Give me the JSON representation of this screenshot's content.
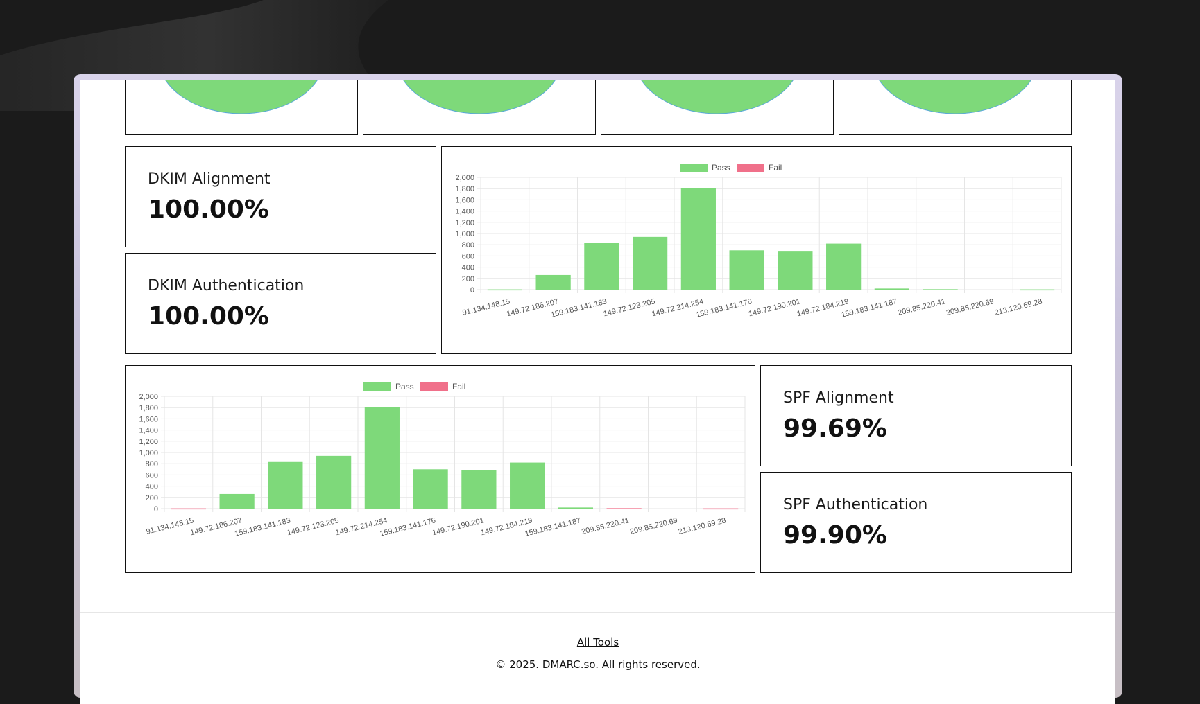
{
  "colors": {
    "pass": "#7ed97a",
    "fail": "#f0708a",
    "grid": "#e5e5e5",
    "axis_text": "#555555"
  },
  "stats": {
    "dkim_alignment": {
      "label": "DKIM Alignment",
      "value": "100.00%"
    },
    "dkim_authentication": {
      "label": "DKIM Authentication",
      "value": "100.00%"
    },
    "spf_alignment": {
      "label": "SPF Alignment",
      "value": "99.69%"
    },
    "spf_authentication": {
      "label": "SPF Authentication",
      "value": "99.90%"
    }
  },
  "footer": {
    "link": "All Tools",
    "copyright": "© 2025. DMARC.so. All rights reserved."
  },
  "chart_data": [
    {
      "type": "bar",
      "legend": [
        "Pass",
        "Fail"
      ],
      "legend_position": "top",
      "grid": true,
      "ylim": [
        0,
        2000
      ],
      "yticks": [
        "0",
        "200",
        "400",
        "600",
        "800",
        "1,000",
        "1,200",
        "1,400",
        "1,600",
        "1,800",
        "2,000"
      ],
      "categories": [
        "91.134.148.15",
        "149.72.186.207",
        "159.183.141.183",
        "149.72.123.205",
        "149.72.214.254",
        "159.183.141.176",
        "149.72.190.201",
        "149.72.184.219",
        "159.183.141.187",
        "209.85.220.41",
        "209.85.220.69",
        "213.120.69.28"
      ],
      "series": [
        {
          "name": "Pass",
          "values": [
            5,
            260,
            830,
            940,
            1810,
            700,
            690,
            820,
            20,
            8,
            0,
            5
          ]
        },
        {
          "name": "Fail",
          "values": [
            0,
            0,
            0,
            0,
            0,
            0,
            0,
            0,
            0,
            0,
            0,
            0
          ]
        }
      ]
    },
    {
      "type": "bar",
      "legend": [
        "Pass",
        "Fail"
      ],
      "legend_position": "top",
      "grid": true,
      "ylim": [
        0,
        2000
      ],
      "yticks": [
        "0",
        "200",
        "400",
        "600",
        "800",
        "1,000",
        "1,200",
        "1,400",
        "1,600",
        "1,800",
        "2,000"
      ],
      "categories": [
        "91.134.148.15",
        "149.72.186.207",
        "159.183.141.183",
        "149.72.123.205",
        "149.72.214.254",
        "159.183.141.176",
        "149.72.190.201",
        "149.72.184.219",
        "159.183.141.187",
        "209.85.220.41",
        "209.85.220.69",
        "213.120.69.28"
      ],
      "series": [
        {
          "name": "Pass",
          "values": [
            0,
            260,
            830,
            940,
            1810,
            700,
            690,
            820,
            20,
            0,
            0,
            0
          ]
        },
        {
          "name": "Fail",
          "values": [
            5,
            0,
            0,
            0,
            0,
            0,
            0,
            0,
            0,
            8,
            0,
            5
          ]
        }
      ]
    }
  ]
}
